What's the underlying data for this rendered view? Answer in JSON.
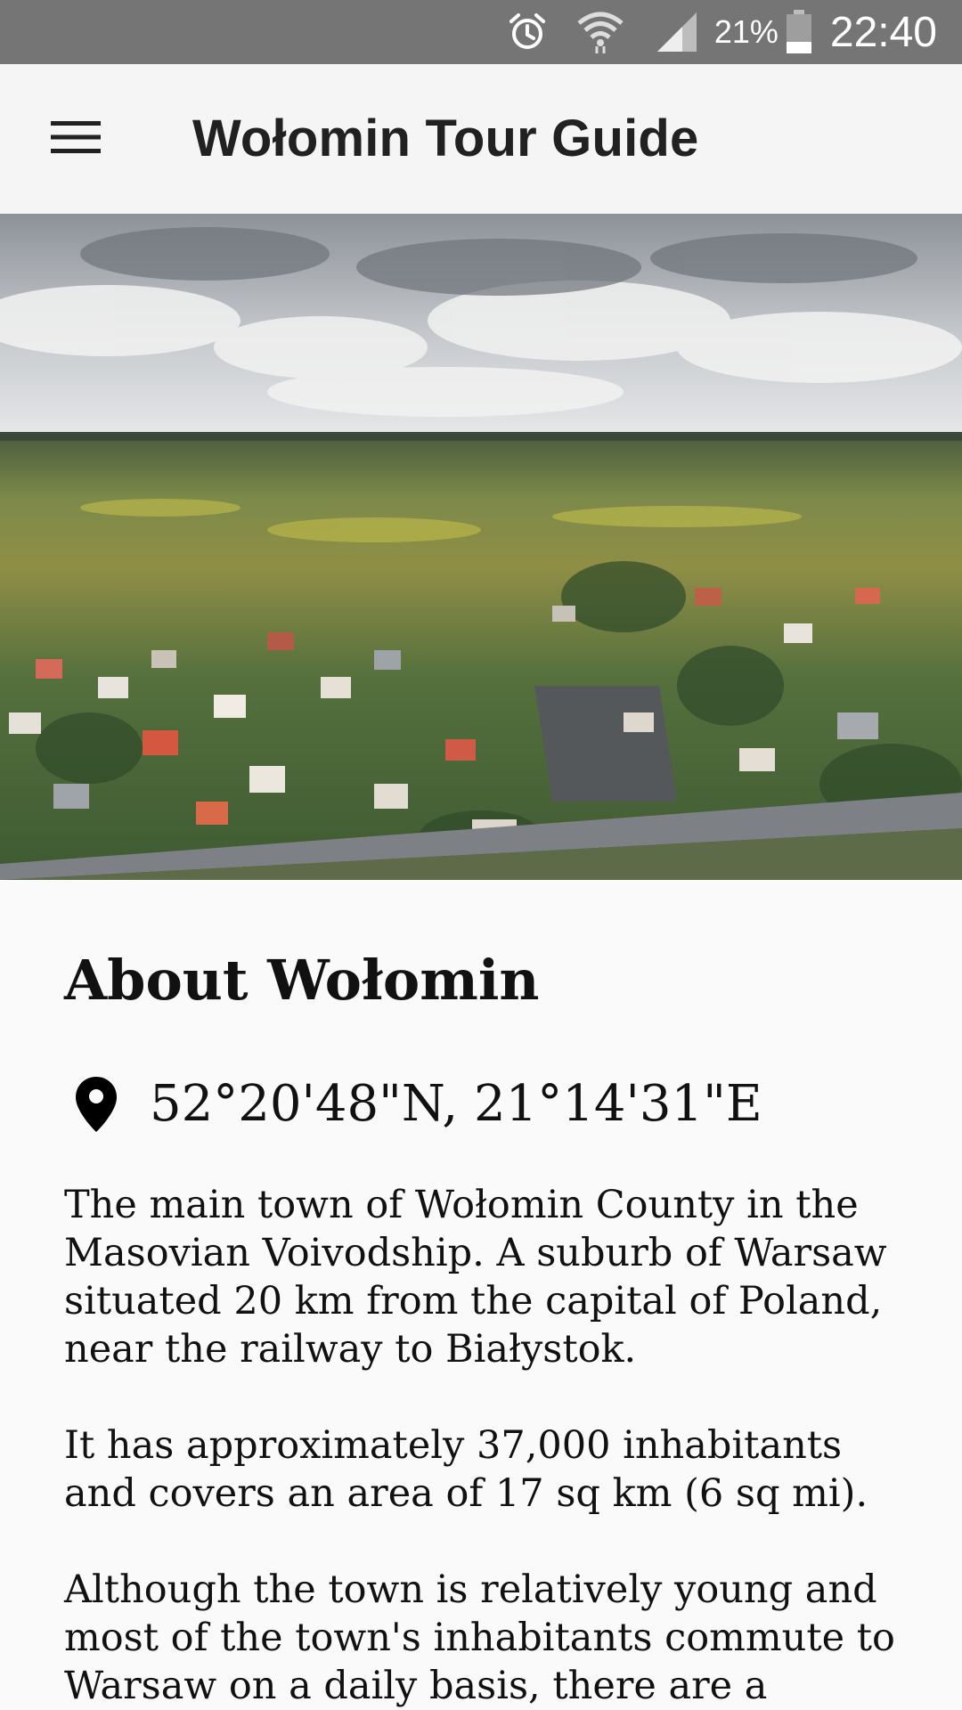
{
  "status_bar": {
    "icons": [
      "alarm-icon",
      "wifi-icon",
      "signal-icon",
      "battery-icon"
    ],
    "battery_percent": "21%",
    "time": "22:40"
  },
  "app_bar": {
    "menu_icon": "hamburger-menu-icon",
    "title": "Wołomin Tour Guide"
  },
  "hero": {
    "description_icon": "aerial-town-photo"
  },
  "about": {
    "title": "About Wołomin",
    "location_icon": "map-pin-icon",
    "coordinates": "52°20'48\"N, 21°14'31\"E",
    "paragraphs": [
      "The main town of Wołomin County in the Masovian Voivodship. A suburb of Warsaw situated 20 km from the capital of Poland, near the railway to Białystok.",
      "It has approximately 37,000 inhabitants and covers an area of 17 sq km (6 sq mi).",
      "Although the town is relatively young and most of the town's inhabitants commute to Warsaw on a daily basis, there are a"
    ]
  },
  "colors": {
    "status_bar": "#757575",
    "app_bar": "#f5f5f5",
    "background": "#fafafa",
    "text": "#111111"
  }
}
